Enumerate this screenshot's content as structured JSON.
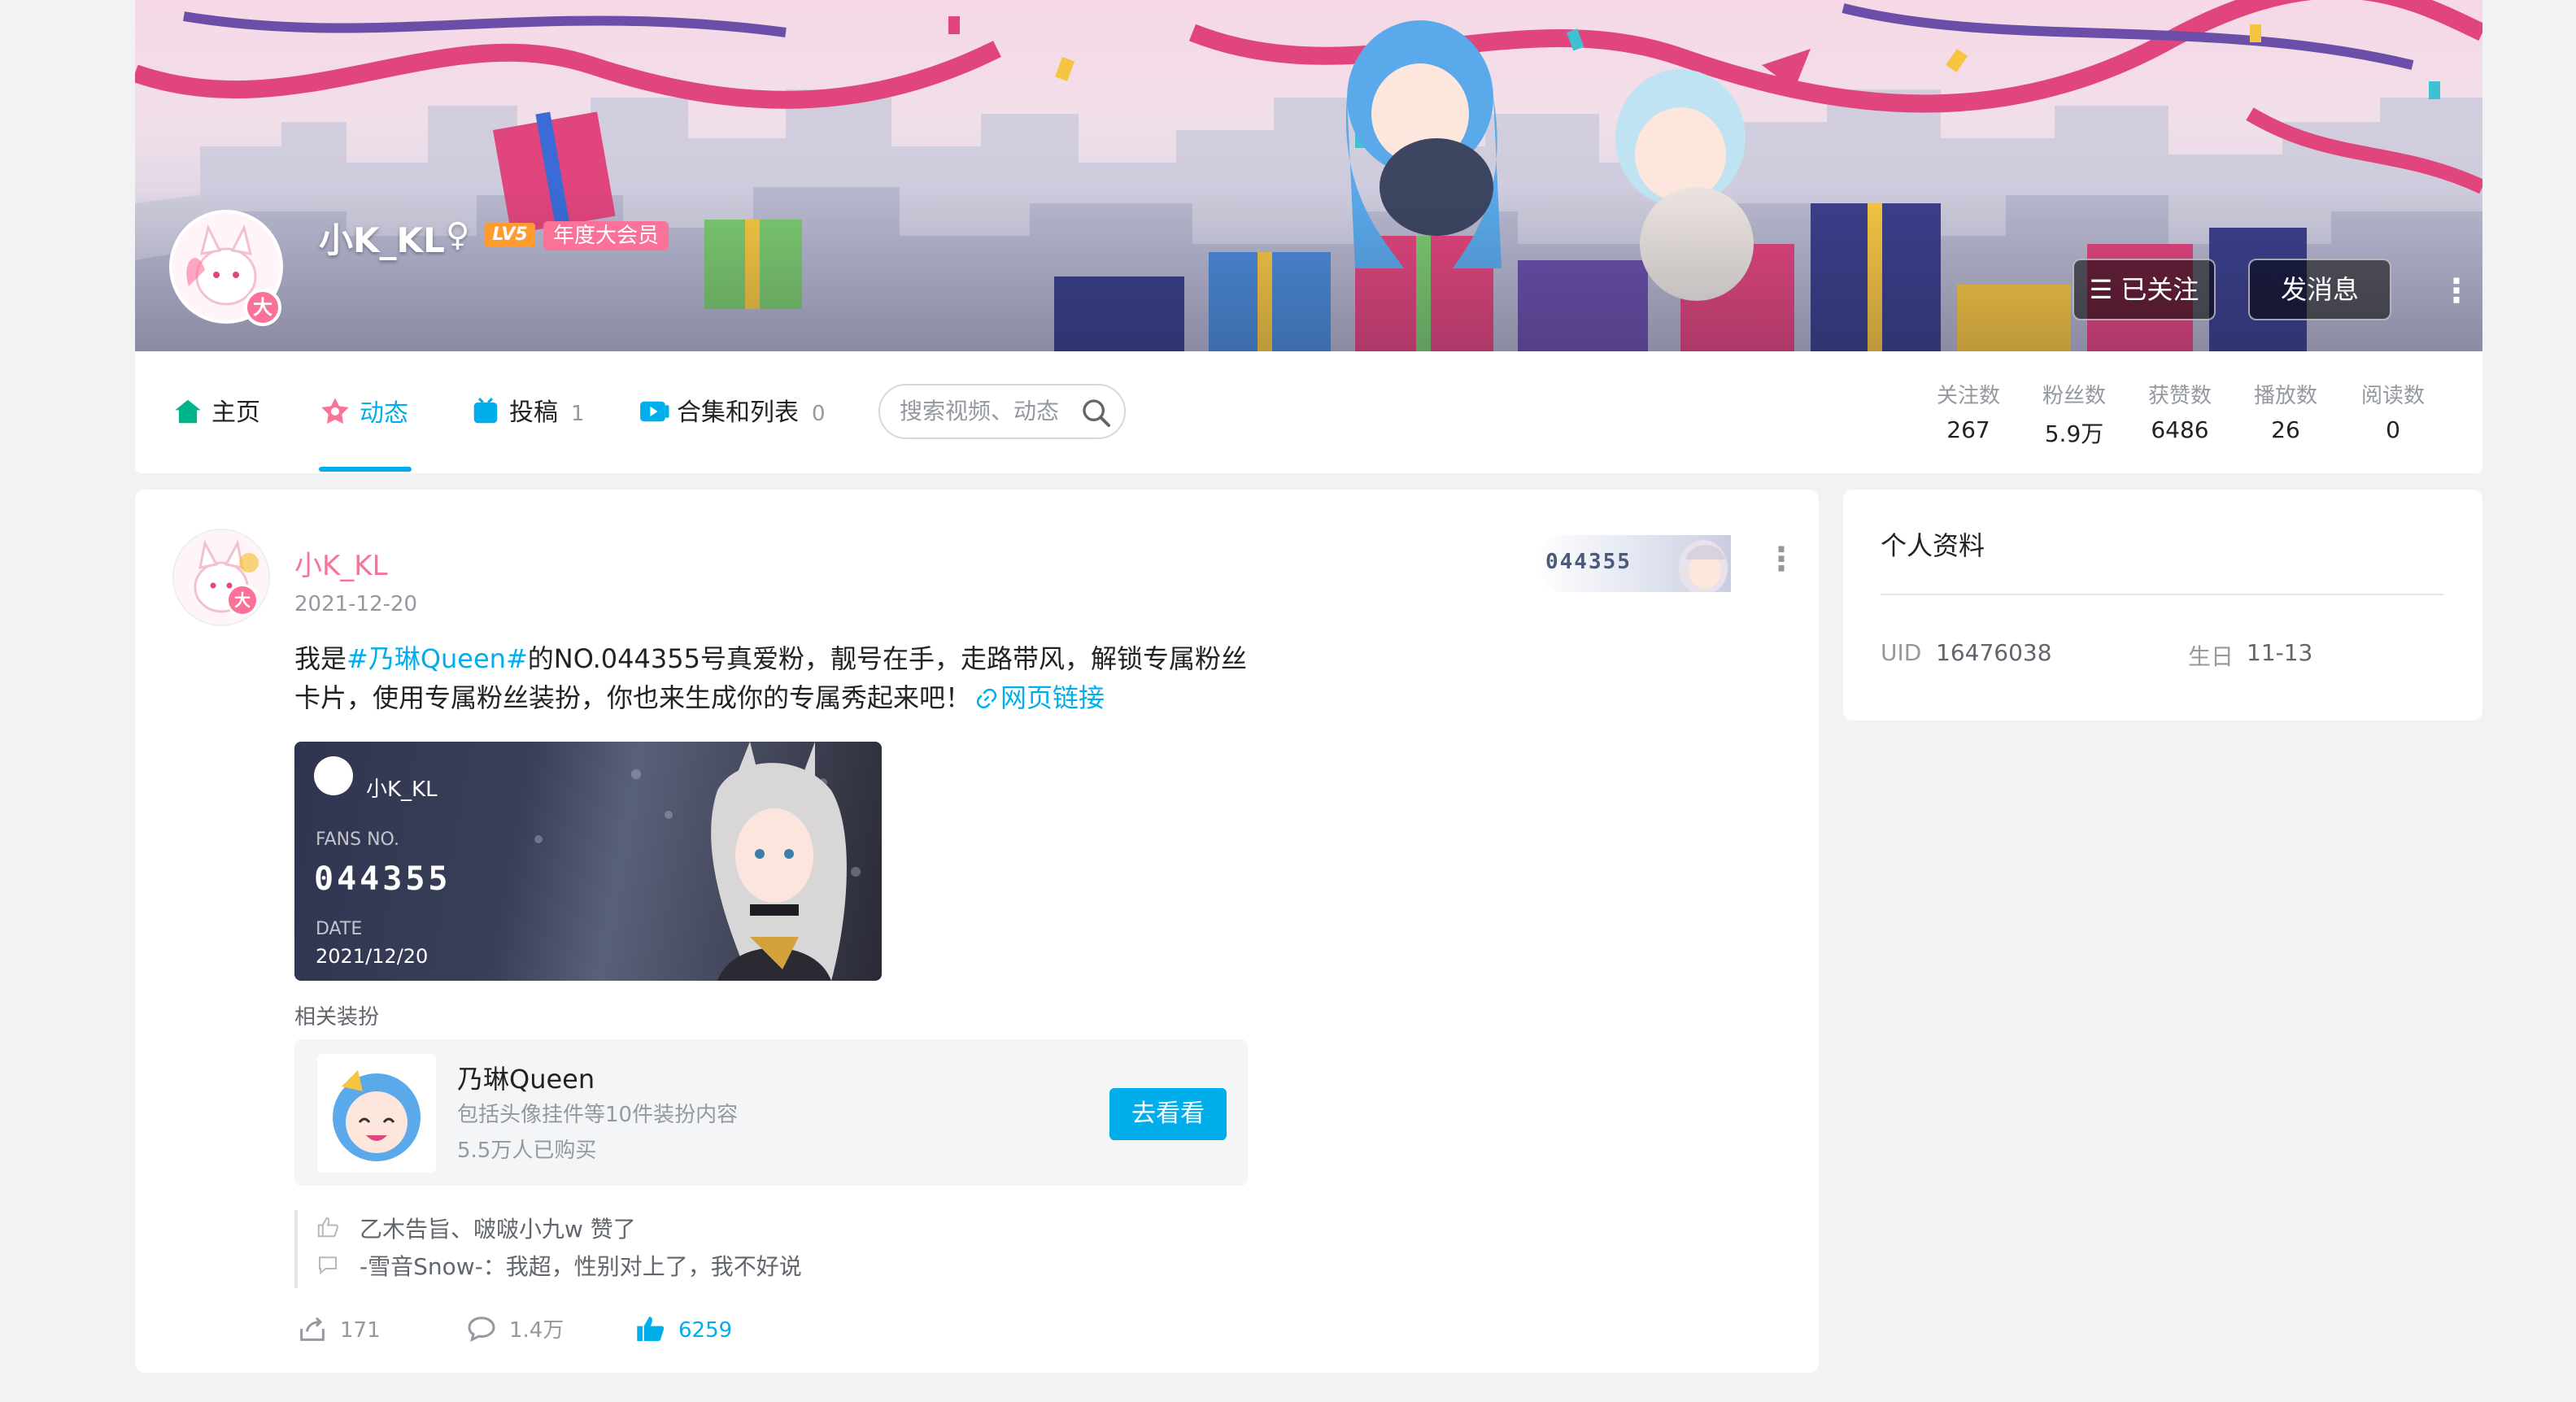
{
  "profile": {
    "name": "小K_KL",
    "gender_symbol": "♀",
    "level": "LV5",
    "vip_label": "年度大会员",
    "avatar_badge": "大",
    "followed_label": "☰ 已关注",
    "message_label": "发消息",
    "more_symbol": "⋮"
  },
  "nav": {
    "home": "主页",
    "dynamic": "动态",
    "uploads": "投稿",
    "uploads_count": "1",
    "collections": "合集和列表",
    "collections_count": "0",
    "search_placeholder": "搜索视频、动态"
  },
  "stats": [
    {
      "label": "关注数",
      "value": "267"
    },
    {
      "label": "粉丝数",
      "value": "5.9万"
    },
    {
      "label": "获赞数",
      "value": "6486"
    },
    {
      "label": "播放数",
      "value": "26"
    },
    {
      "label": "阅读数",
      "value": "0"
    }
  ],
  "post": {
    "author": "小K_KL",
    "date": "2021-12-20",
    "fan_number": "044355",
    "text_prefix": "我是",
    "text_tag": "#乃琳Queen#",
    "text_body": "的NO.044355号真爱粉，靓号在手，走路带风，解锁专属粉丝卡片，使用专属粉丝装扮，你也来生成你的专属秀起来吧！",
    "link_text": "网页链接",
    "card": {
      "name": "小K_KL",
      "fans_no_label": "FANS NO.",
      "fans_no": "044355",
      "date_label": "DATE",
      "date": "2021/12/20"
    },
    "related_label": "相关装扮",
    "related": {
      "title": "乃琳Queen",
      "desc": "包括头像挂件等10件装扮内容",
      "buyers": "5.5万人已购买",
      "button": "去看看"
    },
    "liked_by": "乙木告旨、啵啵小九w 赞了",
    "top_comment": "-雪音Snow-：我超，性别对上了，我不好说",
    "actions": {
      "shares": "171",
      "comments": "1.4万",
      "likes": "6259"
    }
  },
  "side": {
    "title": "个人资料",
    "uid_label": "UID",
    "uid": "16476038",
    "birthday_label": "生日",
    "birthday": "11-13"
  },
  "colors": {
    "accent": "#00aeec",
    "pink": "#fb7299",
    "muted": "#9499a0"
  }
}
